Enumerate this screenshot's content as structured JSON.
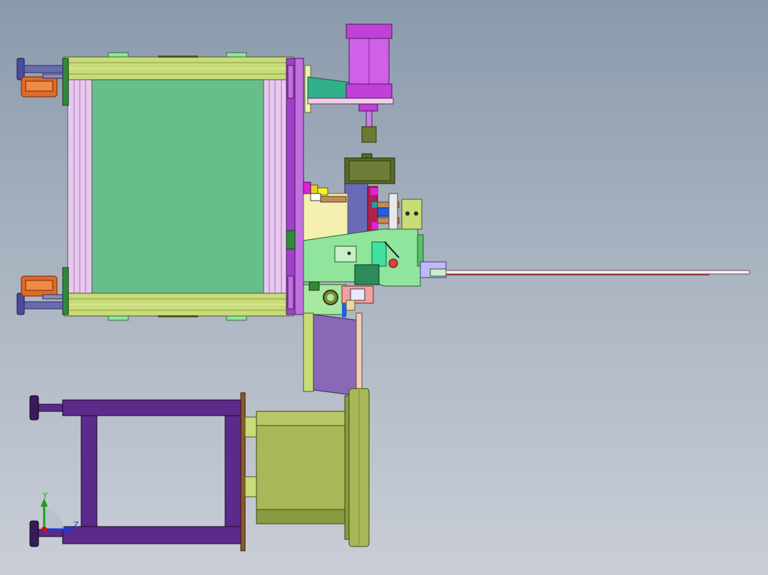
{
  "viewport": {
    "background_top": "#8a9aac",
    "background_bottom": "#c9ced6"
  },
  "triad": {
    "y_label": "Y",
    "z_label": "Z",
    "y_color": "#1aa01a",
    "z_color": "#1a3ad8",
    "x_color": "#cc1111"
  },
  "colors": {
    "frame_yellow": "#c8dc78",
    "panel_green": "#66bf8a",
    "side_pink": "#e8c8ee",
    "purple_plate": "#a040c8",
    "cylinder_magenta": "#c040d8",
    "teal_bracket": "#2fb08a",
    "caster_orange": "#e06a28",
    "stand_purple": "#5c2a8a",
    "drum_olive": "#a8b858",
    "slide_lavender": "#8a68b8",
    "cream_block": "#f4f0b0",
    "light_green_block": "#8fe59b"
  }
}
